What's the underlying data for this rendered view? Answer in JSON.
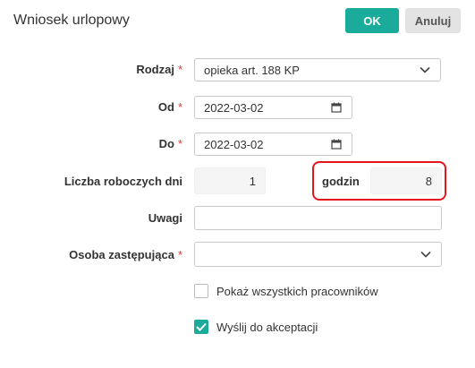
{
  "header": {
    "title": "Wniosek urlopowy",
    "ok_label": "OK",
    "cancel_label": "Anuluj"
  },
  "form": {
    "rodzaj": {
      "label": "Rodzaj",
      "required": "*",
      "value": "opieka art. 188 KP"
    },
    "od": {
      "label": "Od",
      "required": "*",
      "value": "2022-03-02"
    },
    "do": {
      "label": "Do",
      "required": "*",
      "value": "2022-03-02"
    },
    "liczba": {
      "label": "Liczba roboczych dni",
      "value": "1"
    },
    "godzin": {
      "label": "godzin",
      "value": "8"
    },
    "uwagi": {
      "label": "Uwagi",
      "value": ""
    },
    "osoba": {
      "label": "Osoba zastępująca",
      "required": "*",
      "value": ""
    },
    "pokaz": {
      "label": "Pokaż wszystkich pracowników",
      "checked": false
    },
    "wyslij": {
      "label": "Wyślij do akceptacji",
      "checked": true
    }
  },
  "icons": {
    "dropdown": "chevron-down-icon",
    "calendar": "calendar-icon",
    "check": "check-icon"
  },
  "colors": {
    "accent": "#1aab9a",
    "required": "#e2373f",
    "highlight": "#e8141b"
  }
}
